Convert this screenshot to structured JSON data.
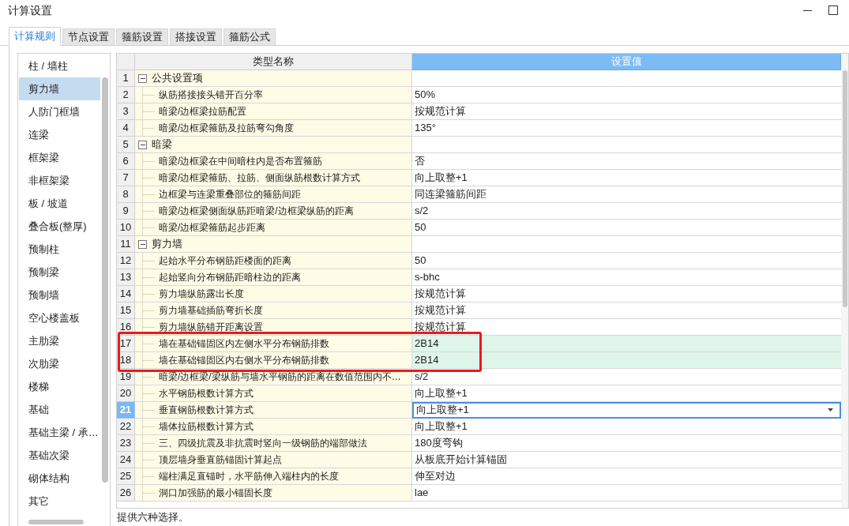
{
  "window": {
    "title": "计算设置"
  },
  "window_buttons": [
    {
      "kind": "minimize"
    },
    {
      "kind": "maximize"
    }
  ],
  "tabs": [
    {
      "label": "计算规则",
      "selected": true
    },
    {
      "label": "节点设置",
      "selected": false
    },
    {
      "label": "箍筋设置",
      "selected": false
    },
    {
      "label": "搭接设置",
      "selected": false
    },
    {
      "label": "箍筋公式",
      "selected": false
    }
  ],
  "sidebar": {
    "items": [
      {
        "label": "柱 / 墙柱",
        "selected": false
      },
      {
        "label": "剪力墙",
        "selected": true
      },
      {
        "label": "人防门框墙",
        "selected": false
      },
      {
        "label": "连梁",
        "selected": false
      },
      {
        "label": "框架梁",
        "selected": false
      },
      {
        "label": "非框架梁",
        "selected": false
      },
      {
        "label": "板 / 坡道",
        "selected": false
      },
      {
        "label": "叠合板(整厚)",
        "selected": false
      },
      {
        "label": "预制柱",
        "selected": false
      },
      {
        "label": "预制梁",
        "selected": false
      },
      {
        "label": "预制墙",
        "selected": false
      },
      {
        "label": "空心楼盖板",
        "selected": false
      },
      {
        "label": "主肋梁",
        "selected": false
      },
      {
        "label": "次肋梁",
        "selected": false
      },
      {
        "label": "楼梯",
        "selected": false
      },
      {
        "label": "基础",
        "selected": false
      },
      {
        "label": "基础主梁 / 承…",
        "selected": false
      },
      {
        "label": "基础次梁",
        "selected": false
      },
      {
        "label": "砌体结构",
        "selected": false
      },
      {
        "label": "其它",
        "selected": false
      }
    ]
  },
  "table": {
    "columns": [
      {
        "label": "类型名称",
        "selected": false
      },
      {
        "label": "设置值",
        "selected": true
      }
    ],
    "rows": [
      {
        "number": "1",
        "kind": "group",
        "expanded": true,
        "name": "公共设置项",
        "selected": false,
        "marked": false
      },
      {
        "number": "2",
        "kind": "item",
        "name": "纵筋搭接接头错开百分率",
        "value": "50%",
        "selected": false,
        "marked": false
      },
      {
        "number": "3",
        "kind": "item",
        "name": "暗梁/边框梁拉筋配置",
        "value": "按规范计算",
        "selected": false,
        "marked": false
      },
      {
        "number": "4",
        "kind": "item",
        "name": "暗梁/边框梁箍筋及拉筋弯勾角度",
        "value": "135°",
        "selected": false,
        "marked": false
      },
      {
        "number": "5",
        "kind": "group",
        "expanded": true,
        "name": "暗梁",
        "selected": false,
        "marked": false
      },
      {
        "number": "6",
        "kind": "item",
        "name": "暗梁/边框梁在中间暗柱内是否布置箍筋",
        "value": "否",
        "selected": false,
        "marked": false
      },
      {
        "number": "7",
        "kind": "item",
        "name": "暗梁/边框梁箍筋、拉筋、侧面纵筋根数计算方式",
        "value": "向上取整+1",
        "selected": false,
        "marked": false
      },
      {
        "number": "8",
        "kind": "item",
        "name": "边框梁与连梁重叠部位的箍筋间距",
        "value": "同连梁箍筋间距",
        "selected": false,
        "marked": false
      },
      {
        "number": "9",
        "kind": "item",
        "name": "暗梁/边框梁侧面纵筋距暗梁/边框梁纵筋的距离",
        "value": "s/2",
        "selected": false,
        "marked": false
      },
      {
        "number": "10",
        "kind": "item",
        "name": "暗梁/边框梁箍筋起步距离",
        "value": "50",
        "selected": false,
        "marked": false
      },
      {
        "number": "11",
        "kind": "group",
        "expanded": true,
        "name": "剪力墙",
        "selected": false,
        "marked": false
      },
      {
        "number": "12",
        "kind": "item",
        "name": "起始水平分布钢筋距楼面的距离",
        "value": "50",
        "selected": false,
        "marked": false
      },
      {
        "number": "13",
        "kind": "item",
        "name": "起始竖向分布钢筋距暗柱边的距离",
        "value": "s-bhc",
        "selected": false,
        "marked": false
      },
      {
        "number": "14",
        "kind": "item",
        "name": "剪力墙纵筋露出长度",
        "value": "按规范计算",
        "selected": false,
        "marked": false
      },
      {
        "number": "15",
        "kind": "item",
        "name": "剪力墙基础插筋弯折长度",
        "value": "按规范计算",
        "selected": false,
        "marked": false
      },
      {
        "number": "16",
        "kind": "item",
        "name": "剪力墙纵筋错开距离设置",
        "value": "按规范计算",
        "selected": false,
        "marked": false
      },
      {
        "number": "17",
        "kind": "item",
        "name": "墙在基础锚固区内左侧水平分布钢筋排数",
        "value": "2B14",
        "selected": false,
        "marked": true
      },
      {
        "number": "18",
        "kind": "item",
        "name": "墙在基础锚固区内右侧水平分布钢筋排数",
        "value": "2B14",
        "selected": false,
        "marked": true
      },
      {
        "number": "19",
        "kind": "item",
        "name": "暗梁/边框梁/梁纵筋与墙水平钢筋的距离在数值范围内不…",
        "value": "s/2",
        "selected": false,
        "marked": false
      },
      {
        "number": "20",
        "kind": "item",
        "name": "水平钢筋根数计算方式",
        "value": "向上取整+1",
        "selected": false,
        "marked": false
      },
      {
        "number": "21",
        "kind": "item",
        "name": "垂直钢筋根数计算方式",
        "value": "向上取整+1",
        "selected": true,
        "marked": false
      },
      {
        "number": "22",
        "kind": "item",
        "name": "墙体拉筋根数计算方式",
        "value": "向上取整+1",
        "selected": false,
        "marked": false
      },
      {
        "number": "23",
        "kind": "item",
        "name": "三、四级抗震及非抗震时竖向一级钢筋的端部做法",
        "value": "180度弯钩",
        "selected": false,
        "marked": false
      },
      {
        "number": "24",
        "kind": "item",
        "name": "顶层墙身垂直筋锚固计算起点",
        "value": "从板底开始计算锚固",
        "selected": false,
        "marked": false
      },
      {
        "number": "25",
        "kind": "item",
        "name": "端柱满足直锚时，水平筋伸入端柱内的长度",
        "value": "伸至对边",
        "selected": false,
        "marked": false
      },
      {
        "number": "26",
        "kind": "item",
        "name": "洞口加强筋的最小锚固长度",
        "value": "lae",
        "selected": false,
        "marked": false
      }
    ]
  },
  "status_bar": {
    "text": "提供六种选择。"
  }
}
